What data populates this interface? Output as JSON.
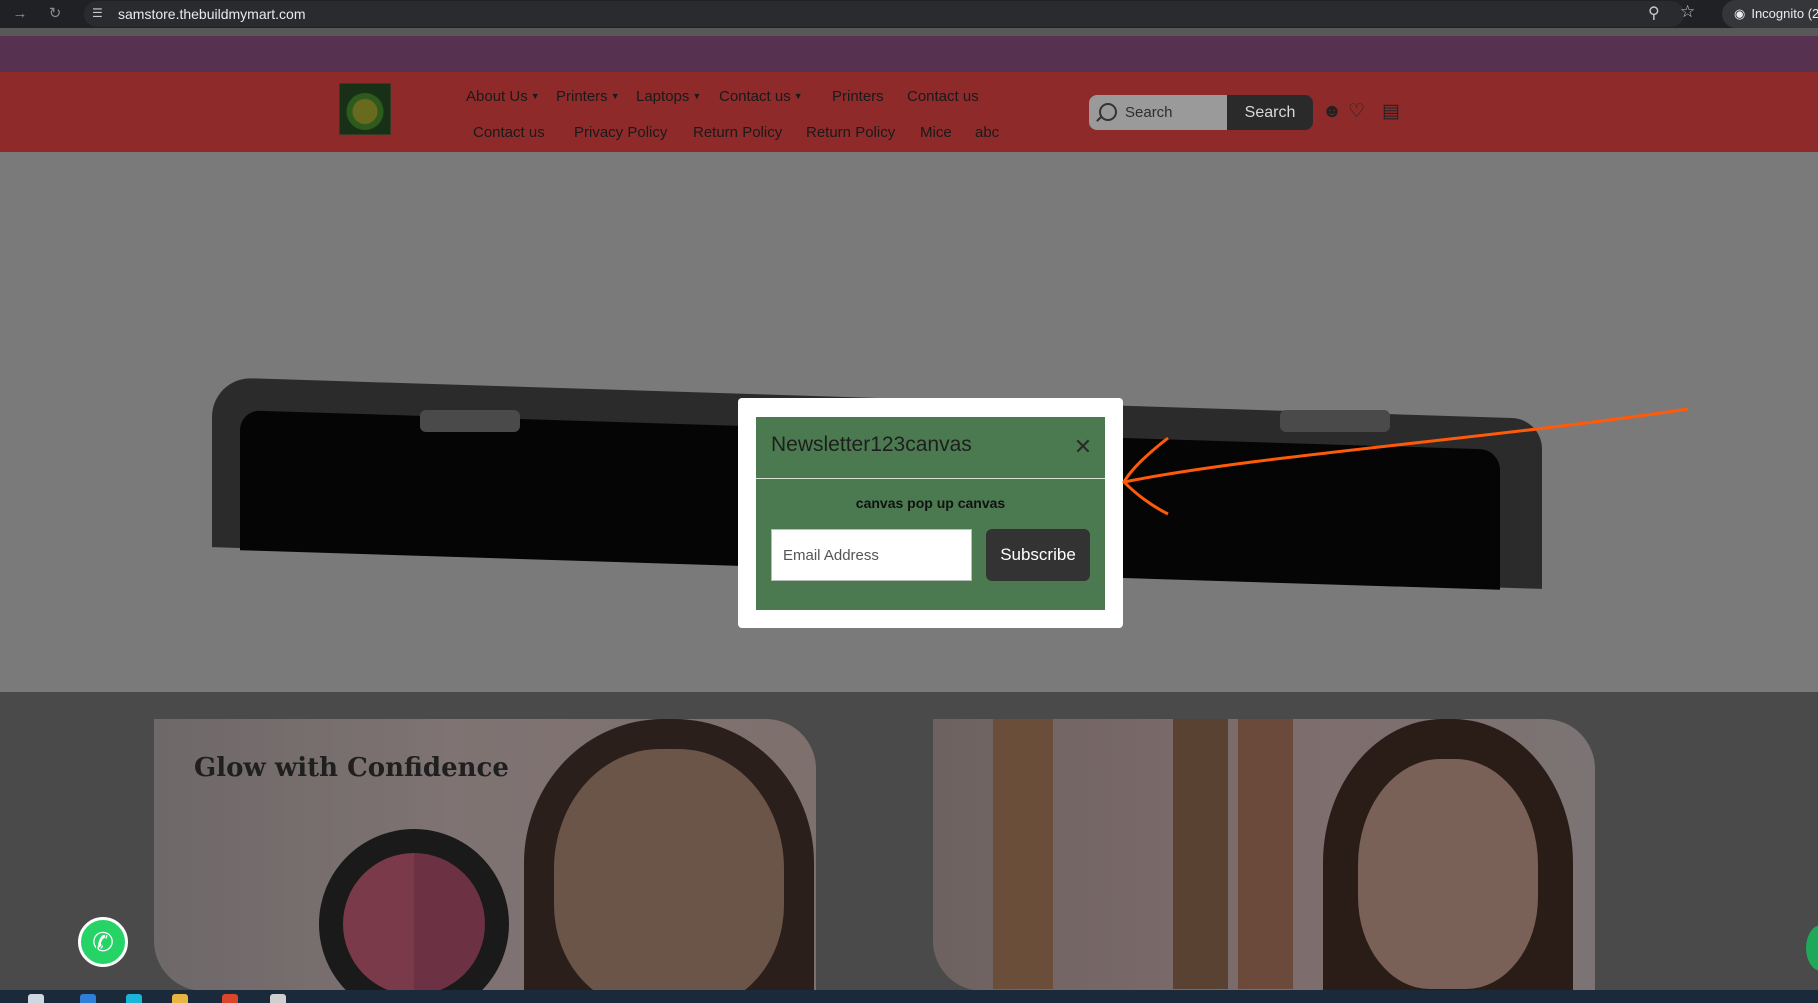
{
  "browser": {
    "url": "samstore.thebuildmymart.com",
    "profile_label": "Incognito (2",
    "icons": [
      "forward-icon",
      "reload-icon",
      "site-info-icon",
      "zoom-icon",
      "bookmark-star-icon",
      "incognito-icon"
    ]
  },
  "header": {
    "nav_row1": [
      {
        "label": "About Us",
        "dropdown": true
      },
      {
        "label": "Printers",
        "dropdown": true
      },
      {
        "label": "Laptops",
        "dropdown": true
      },
      {
        "label": "Contact us",
        "dropdown": true
      },
      {
        "label": "Printers",
        "dropdown": false
      },
      {
        "label": "Contact us",
        "dropdown": false
      }
    ],
    "nav_row2": [
      {
        "label": "Contact us"
      },
      {
        "label": "Privacy Policy"
      },
      {
        "label": "Return Policy"
      },
      {
        "label": "Return Policy"
      },
      {
        "label": "Mice"
      },
      {
        "label": "abc"
      }
    ],
    "search": {
      "placeholder": "Search",
      "button_label": "Search"
    },
    "icons": [
      "account-icon",
      "wishlist-heart-icon",
      "cart-icon"
    ]
  },
  "cards": {
    "card1_title": "Glow with Confidence"
  },
  "popup": {
    "title": "Newsletter123canvas",
    "description": "canvas pop up canvas",
    "email_placeholder": "Email Address",
    "subscribe_label": "Subscribe",
    "header_color": "#4c7a50"
  },
  "colors": {
    "announcement_bar": "#563250",
    "header_bg": "#8e2a2a",
    "annotation_arrow": "#ff5a0a"
  }
}
